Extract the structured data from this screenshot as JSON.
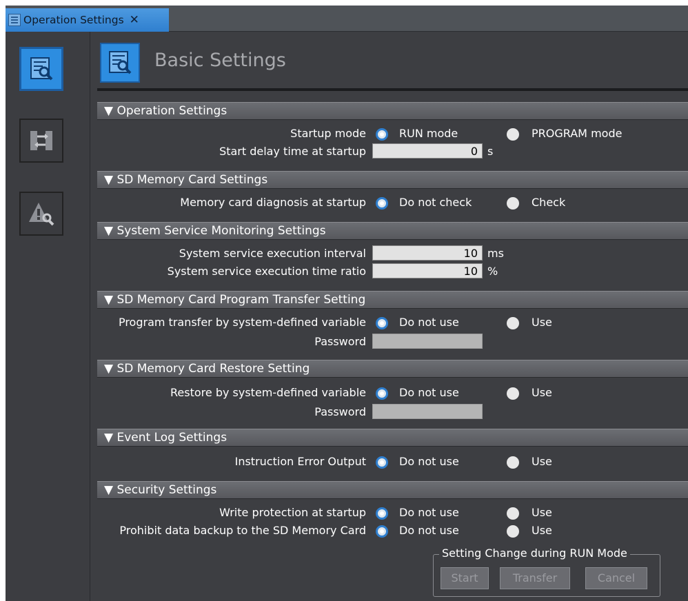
{
  "tab": {
    "title": "Operation Settings",
    "close": "✕"
  },
  "header": {
    "title": "Basic Settings"
  },
  "sections": {
    "operation": {
      "title": "▼ Operation Settings",
      "startup_mode_label": "Startup mode",
      "startup_mode_options": [
        "RUN mode",
        "PROGRAM mode"
      ],
      "startup_mode_selected": "RUN mode",
      "start_delay_label": "Start delay time at startup",
      "start_delay_value": "0",
      "start_delay_unit": "s"
    },
    "sd_card": {
      "title": "▼ SD Memory Card Settings",
      "diagnosis_label": "Memory card diagnosis at startup",
      "diagnosis_options": [
        "Do not check",
        "Check"
      ],
      "diagnosis_selected": "Do not check"
    },
    "monitoring": {
      "title": "▼ System Service Monitoring Settings",
      "interval_label": "System service execution interval",
      "interval_value": "10",
      "interval_unit": "ms",
      "ratio_label": "System service execution time ratio",
      "ratio_value": "10",
      "ratio_unit": "%"
    },
    "program_transfer": {
      "title": "▼ SD Memory Card Program Transfer Setting",
      "transfer_label": "Program transfer by system-defined variable",
      "transfer_options": [
        "Do not use",
        "Use"
      ],
      "transfer_selected": "Do not use",
      "password_label": "Password",
      "password_value": ""
    },
    "restore": {
      "title": "▼ SD Memory Card Restore Setting",
      "restore_label": "Restore by system-defined variable",
      "restore_options": [
        "Do not use",
        "Use"
      ],
      "restore_selected": "Do not use",
      "password_label": "Password",
      "password_value": ""
    },
    "event_log": {
      "title": "▼ Event Log Settings",
      "instruction_error_label": "Instruction Error Output",
      "instruction_error_options": [
        "Do not use",
        "Use"
      ],
      "instruction_error_selected": "Do not use"
    },
    "security": {
      "title": "▼ Security Settings",
      "write_protection_label": "Write protection at startup",
      "write_protection_options": [
        "Do not use",
        "Use"
      ],
      "write_protection_selected": "Do not use",
      "prohibit_backup_label": "Prohibit data backup to the SD Memory Card",
      "prohibit_backup_options": [
        "Do not use",
        "Use"
      ],
      "prohibit_backup_selected": "Do not use"
    }
  },
  "run_mode": {
    "legend": "Setting Change during RUN Mode",
    "buttons": [
      "Start",
      "Transfer",
      "Cancel"
    ]
  },
  "sidebar": {
    "icons": [
      "basic-settings-icon",
      "transfer-settings-icon",
      "maintenance-icon"
    ]
  },
  "colors": {
    "accent": "#2d8de0",
    "background": "#3d3e42",
    "section_header": "#606166"
  }
}
